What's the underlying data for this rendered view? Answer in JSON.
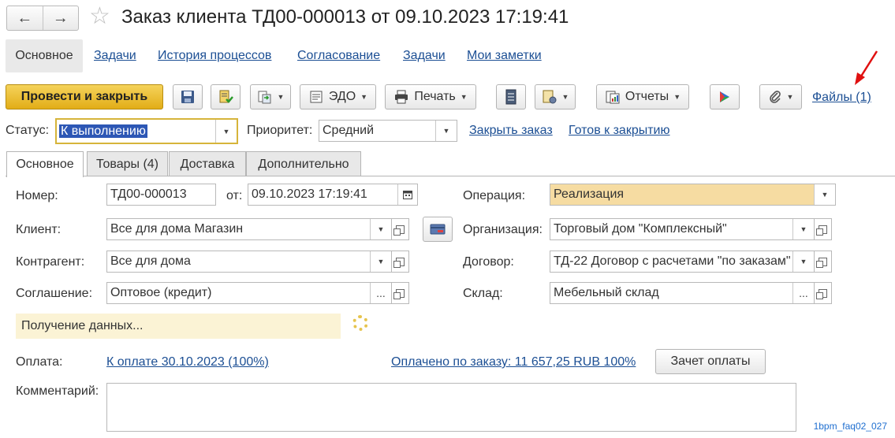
{
  "window": {
    "title": "Заказ клиента ТД00-000013 от 09.10.2023 17:19:41",
    "back_icon": "←",
    "forward_icon": "→"
  },
  "nav_tabs": [
    {
      "label": "Основное",
      "active": true
    },
    {
      "label": "Задачи"
    },
    {
      "label": "История процессов"
    },
    {
      "label": "Согласование"
    },
    {
      "label": "Задачи"
    },
    {
      "label": "Мои заметки"
    }
  ],
  "toolbar": {
    "post_close": "Провести и закрыть",
    "edo": "ЭДО",
    "print": "Печать",
    "reports": "Отчеты",
    "files_link": "Файлы (1)"
  },
  "status_row": {
    "status_label": "Статус:",
    "status_value": "К выполнению",
    "priority_label": "Приоритет:",
    "priority_value": "Средний",
    "close_order": "Закрыть заказ",
    "ready_to_close": "Готов к закрытию"
  },
  "form_tabs": [
    {
      "label": "Основное",
      "active": true
    },
    {
      "label": "Товары (4)"
    },
    {
      "label": "Доставка"
    },
    {
      "label": "Дополнительно"
    }
  ],
  "form": {
    "number_label": "Номер:",
    "number_value": "ТД00-000013",
    "from_label": "от:",
    "date_value": "09.10.2023 17:19:41",
    "operation_label": "Операция:",
    "operation_value": "Реализация",
    "client_label": "Клиент:",
    "client_value": "Все для дома Магазин",
    "organization_label": "Организация:",
    "organization_value": "Торговый дом \"Комплексный\"",
    "counterparty_label": "Контрагент:",
    "counterparty_value": "Все для дома",
    "contract_label": "Договор:",
    "contract_value": "ТД-22 Договор с расчетами \"по заказам\"",
    "agreement_label": "Соглашение:",
    "agreement_value": "Оптовое (кредит)",
    "warehouse_label": "Склад:",
    "warehouse_value": "Мебельный склад",
    "ellipsis": "...",
    "loading_text": "Получение данных...",
    "payment_label": "Оплата:",
    "payment_link": "К оплате 30.10.2023 (100%)",
    "paid_link": "Оплачено по заказу: 11 657,25 RUB 100%",
    "offset_button": "Зачет оплаты",
    "comment_label": "Комментарий:",
    "comment_value": ""
  },
  "watermark": "1bpm_faq02_027",
  "colors": {
    "primary_button": "#e2ad17",
    "link": "#1c4f94",
    "operation_bg": "#f6dca2",
    "notice_bg": "#fbf3d5",
    "status_selection": "#2d57b5",
    "annotation_arrow": "#e01010"
  }
}
